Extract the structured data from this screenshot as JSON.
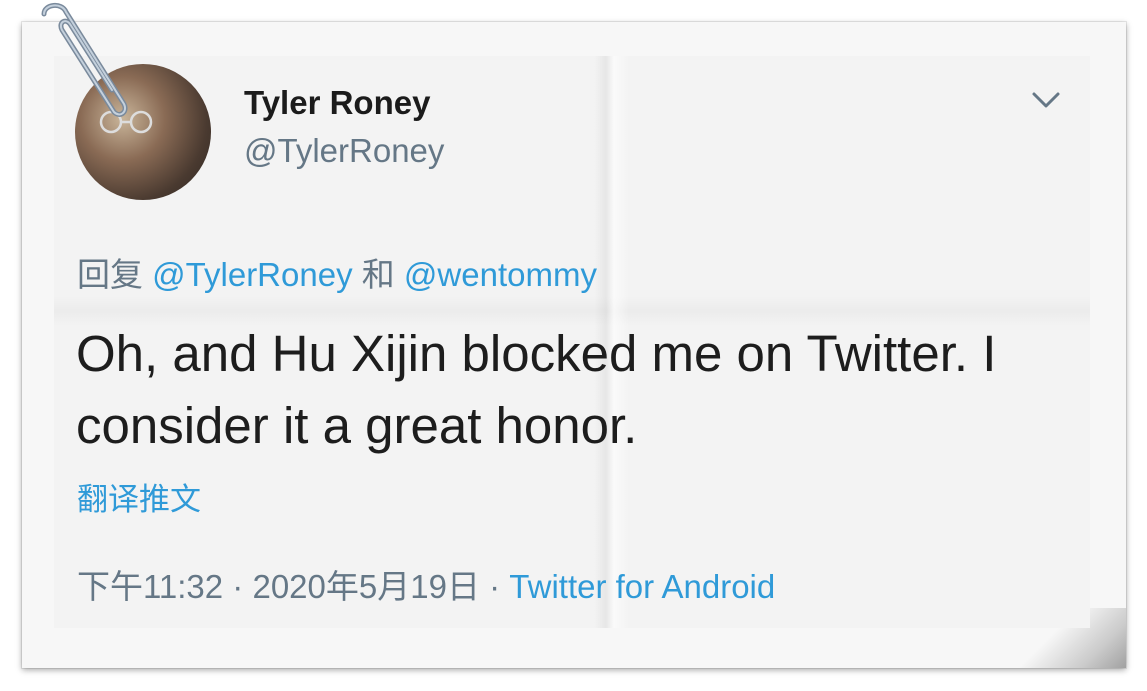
{
  "user": {
    "display_name": "Tyler Roney",
    "handle": "@TylerRoney"
  },
  "reply": {
    "prefix": "回复 ",
    "mention_1": "@TylerRoney",
    "joiner": " 和 ",
    "mention_2": "@wentommy"
  },
  "tweet": {
    "text": "Oh, and Hu Xijin blocked me on Twitter. I consider it a great honor."
  },
  "translate_label": "翻译推文",
  "meta": {
    "time": "下午11:32",
    "sep_1": " · ",
    "date": "2020年5月19日",
    "sep_2": " · ",
    "source": "Twitter for Android"
  },
  "icons": {
    "menu": "chevron-down-icon",
    "attachment": "paperclip-icon"
  },
  "colors": {
    "link": "#2f9ad8",
    "secondary_text": "#657786",
    "primary_text": "#1d1d1d"
  }
}
